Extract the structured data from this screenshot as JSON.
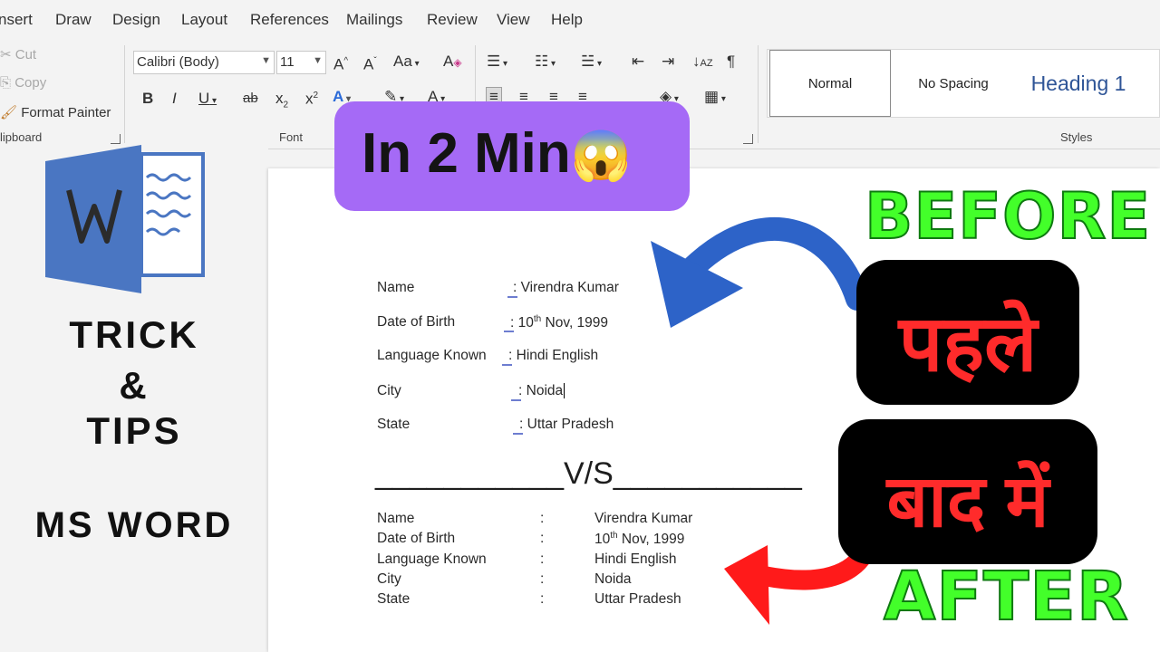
{
  "menu_tabs": [
    "nsert",
    "Draw",
    "Design",
    "Layout",
    "References",
    "Mailings",
    "Review",
    "View",
    "Help"
  ],
  "clipboard": {
    "cut": "Cut",
    "copy": "Copy",
    "format_painter": "Format Painter",
    "group_label": "lipboard"
  },
  "font": {
    "family": "Calibri (Body)",
    "size": "11",
    "group_label": "Font"
  },
  "styles": {
    "items": [
      "Normal",
      "No Spacing",
      "Heading 1"
    ],
    "group_label": "Styles"
  },
  "left_panel": {
    "line1": "TRICK",
    "line2": "&",
    "line3": "TIPS",
    "line4": "MS WORD"
  },
  "badge": {
    "text": "In 2 Min",
    "emoji": "😱"
  },
  "before_section": {
    "rows": [
      {
        "label": "Name",
        "value": "Virendra Kumar"
      },
      {
        "label": "Date of Birth",
        "value_prefix": "10",
        "value_sup": "th",
        "value_suffix": " Nov, 1999"
      },
      {
        "label": "Language Known",
        "value": "Hindi English"
      },
      {
        "label": "City",
        "value": "Noida"
      },
      {
        "label": "State",
        "value": "Uttar Pradesh"
      }
    ],
    "colon": ":"
  },
  "vs_line": "___________V/S___________",
  "after_section": {
    "rows": [
      {
        "label": "Name",
        "value": "Virendra Kumar"
      },
      {
        "label": "Date of Birth",
        "value_prefix": "10",
        "value_sup": "th",
        "value_suffix": " Nov, 1999"
      },
      {
        "label": "Language Known",
        "value": "Hindi English"
      },
      {
        "label": "City",
        "value": "Noida"
      },
      {
        "label": "State",
        "value": "Uttar Pradesh"
      }
    ],
    "colon": ":"
  },
  "overlay": {
    "before_label": "BEFORE",
    "before_hindi": "पहले",
    "after_hindi": "बाद में",
    "after_label": "AFTER"
  },
  "colors": {
    "badge": "#a56af6",
    "hindi_red": "#ff2b2b",
    "green_label": "#43ff2a",
    "arrow_blue": "#2d63c8",
    "arrow_red": "#ff1a1a",
    "word_blue": "#4a76c2"
  }
}
